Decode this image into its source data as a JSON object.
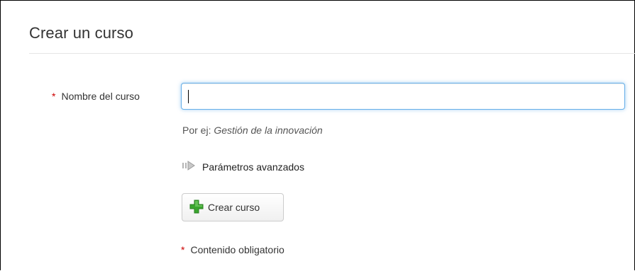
{
  "page": {
    "title": "Crear un curso"
  },
  "form": {
    "required_marker": "*",
    "name_label": "Nombre del curso",
    "name_value": "",
    "help_prefix": "Por ej:",
    "help_example": "Gestión de la innovación",
    "advanced_label": "Parámetros avanzados",
    "advanced_icon": "arrow-right-icon",
    "submit_label": "Crear curso",
    "submit_icon": "green-plus-icon",
    "mandatory_note": "Contenido obligatorio"
  },
  "colors": {
    "required": "#cc0000",
    "focus_border": "#66afe9",
    "plus_icon": "#3aa62e"
  }
}
